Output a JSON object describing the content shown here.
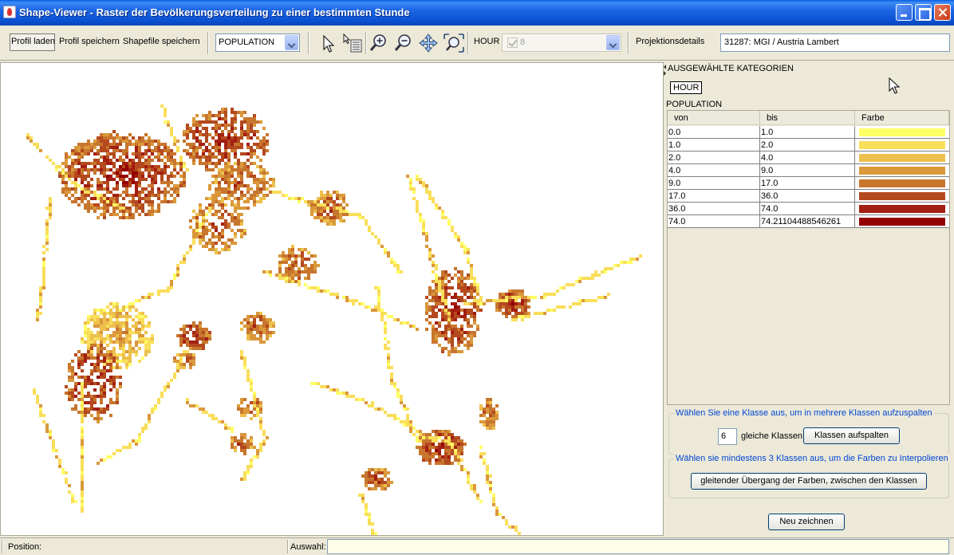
{
  "window": {
    "title": "Shape-Viewer - Raster der Bevölkerungsverteilung zu einer bestimmten Stunde"
  },
  "toolbar": {
    "load_profile": "Profil laden",
    "save_profile": "Profil speichern",
    "save_shapefile": "Shapefile speichern",
    "attribute_select": "POPULATION",
    "hour_label": "HOUR",
    "hour_value": "8",
    "projection_label": "Projektionsdetails",
    "projection_value": "31287: MGI / Austria Lambert",
    "tools": [
      "select-arrow-icon",
      "identify-icon",
      "zoom-in-icon",
      "zoom-out-icon",
      "pan-icon",
      "zoom-extent-icon"
    ]
  },
  "panel": {
    "selected_categories_header": "AUSGEWÄHLTE KATEGORIEN",
    "category_tag": "HOUR",
    "population_label": "POPULATION",
    "columns": [
      "von",
      "bis",
      "Farbe"
    ],
    "classes": [
      {
        "von": "0.0",
        "bis": "1.0",
        "color": "#FFFF66"
      },
      {
        "von": "1.0",
        "bis": "2.0",
        "color": "#F9DE5A"
      },
      {
        "von": "2.0",
        "bis": "4.0",
        "color": "#EDC04D"
      },
      {
        "von": "4.0",
        "bis": "9.0",
        "color": "#DA983B"
      },
      {
        "von": "9.0",
        "bis": "17.0",
        "color": "#C8762E"
      },
      {
        "von": "17.0",
        "bis": "36.0",
        "color": "#B4491E"
      },
      {
        "von": "36.0",
        "bis": "74.0",
        "color": "#A31F12"
      },
      {
        "von": "74.0",
        "bis": "74.21104488546261",
        "color": "#930000"
      }
    ],
    "split_group": {
      "legend": "Wählen Sie eine Klasse aus, um in mehrere Klassen aufzuspalten",
      "count": "6",
      "count_label": "gleiche Klassen",
      "button": "Klassen aufspalten"
    },
    "interpolate_group": {
      "legend": "Wählen sie mindestens 3 Klassen aus, um die Farben zu Interpolieren",
      "button": "gleitender Übergang der Farben, zwischen den Klassen"
    },
    "redraw_button": "Neu zeichnen"
  },
  "statusbar": {
    "position_label": "Position:",
    "position_value": "",
    "selection_label": "Auswahl:",
    "selection_value": ""
  },
  "map": {
    "palette": [
      "#FFFF66",
      "#F9DE5A",
      "#EDC04D",
      "#DA983B",
      "#C8762E",
      "#B4491E",
      "#A31F12",
      "#930000"
    ]
  }
}
